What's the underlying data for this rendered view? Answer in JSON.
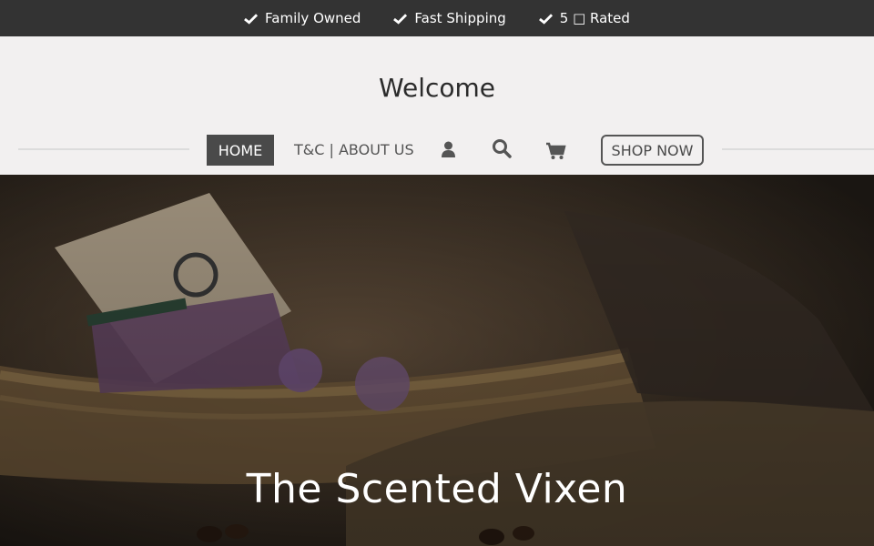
{
  "topbar": {
    "items": [
      {
        "label": "Family Owned",
        "icon": "check-icon"
      },
      {
        "label": "Fast Shipping",
        "icon": "check-icon"
      },
      {
        "label": "5 □ Rated",
        "icon": "check-icon"
      }
    ]
  },
  "header": {
    "title": "Welcome",
    "nav": {
      "home": "HOME",
      "about": "T&C | ABOUT US",
      "shop": "SHOP NOW"
    },
    "icons": [
      "user-icon",
      "search-icon",
      "cart-icon"
    ]
  },
  "hero": {
    "title": "The Scented Vixen"
  },
  "colors": {
    "topbar_bg": "#333333",
    "header_bg": "#f2f0f0",
    "home_bg": "#4a4a4a",
    "text_dark": "#2b2b2b"
  }
}
